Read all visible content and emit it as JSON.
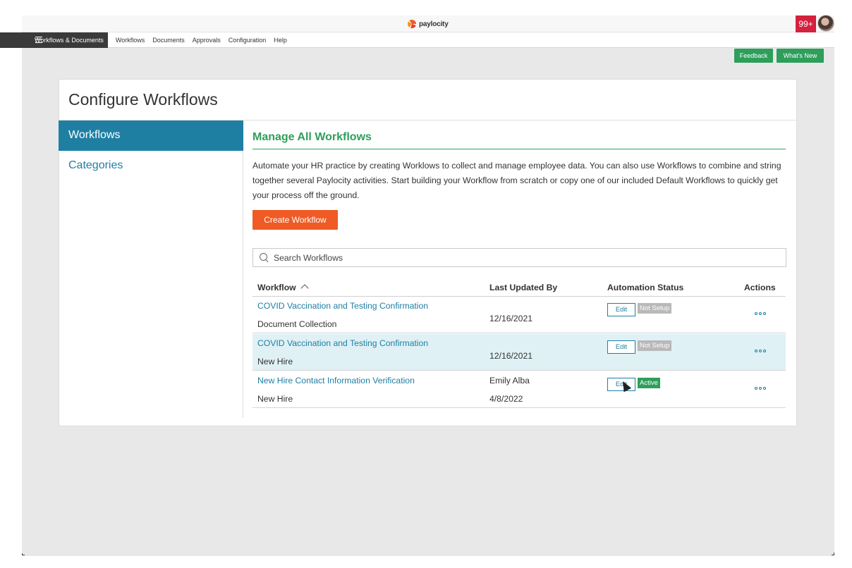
{
  "app": {
    "logo_text": "paylocity",
    "notification_count": "99+"
  },
  "nav": {
    "main_label": "Workflows & Documents",
    "items": [
      {
        "label": "Workflows"
      },
      {
        "label": "Documents"
      },
      {
        "label": "Approvals"
      },
      {
        "label": "Configuration"
      },
      {
        "label": "Help"
      }
    ]
  },
  "header_buttons": {
    "feedback": "Feedback",
    "whats_new": "What's New"
  },
  "page": {
    "title": "Configure Workflows"
  },
  "sidebar": {
    "items": [
      {
        "label": "Workflows",
        "active": true
      },
      {
        "label": "Categories",
        "active": false
      }
    ]
  },
  "main": {
    "section_title": "Manage All Workflows",
    "description": "Automate your HR practice by creating Worklows to collect and manage employee data. You can also use Workflows to combine and string together several Paylocity activities. Start building your Workflow from scratch or copy one of our included Default Workflows to quickly get your process off the ground.",
    "create_button": "Create Workflow",
    "search_placeholder": "Search Workflows",
    "columns": {
      "workflow": "Workflow",
      "last_updated_by": "Last Updated By",
      "automation_status": "Automation Status",
      "actions": "Actions"
    },
    "rows": [
      {
        "name": "COVID Vaccination and Testing Confirmation",
        "category": "Document Collection",
        "updated_by": "",
        "updated_date": "12/16/2021",
        "edit_label": "Edit",
        "status": "Not Setup"
      },
      {
        "name": "COVID Vaccination and Testing Confirmation",
        "category": "New Hire",
        "updated_by": "",
        "updated_date": "12/16/2021",
        "edit_label": "Edit",
        "status": "Not Setup"
      },
      {
        "name": "New Hire Contact Information Verification",
        "category": "New Hire",
        "updated_by": "Emily Alba",
        "updated_date": "4/8/2022",
        "edit_label": "Edit",
        "status": "Active"
      }
    ]
  },
  "colors": {
    "accent_blue": "#1f7fa3",
    "accent_green": "#2e9e5b",
    "create_orange": "#f05a24",
    "badge_red": "#d4213d"
  }
}
